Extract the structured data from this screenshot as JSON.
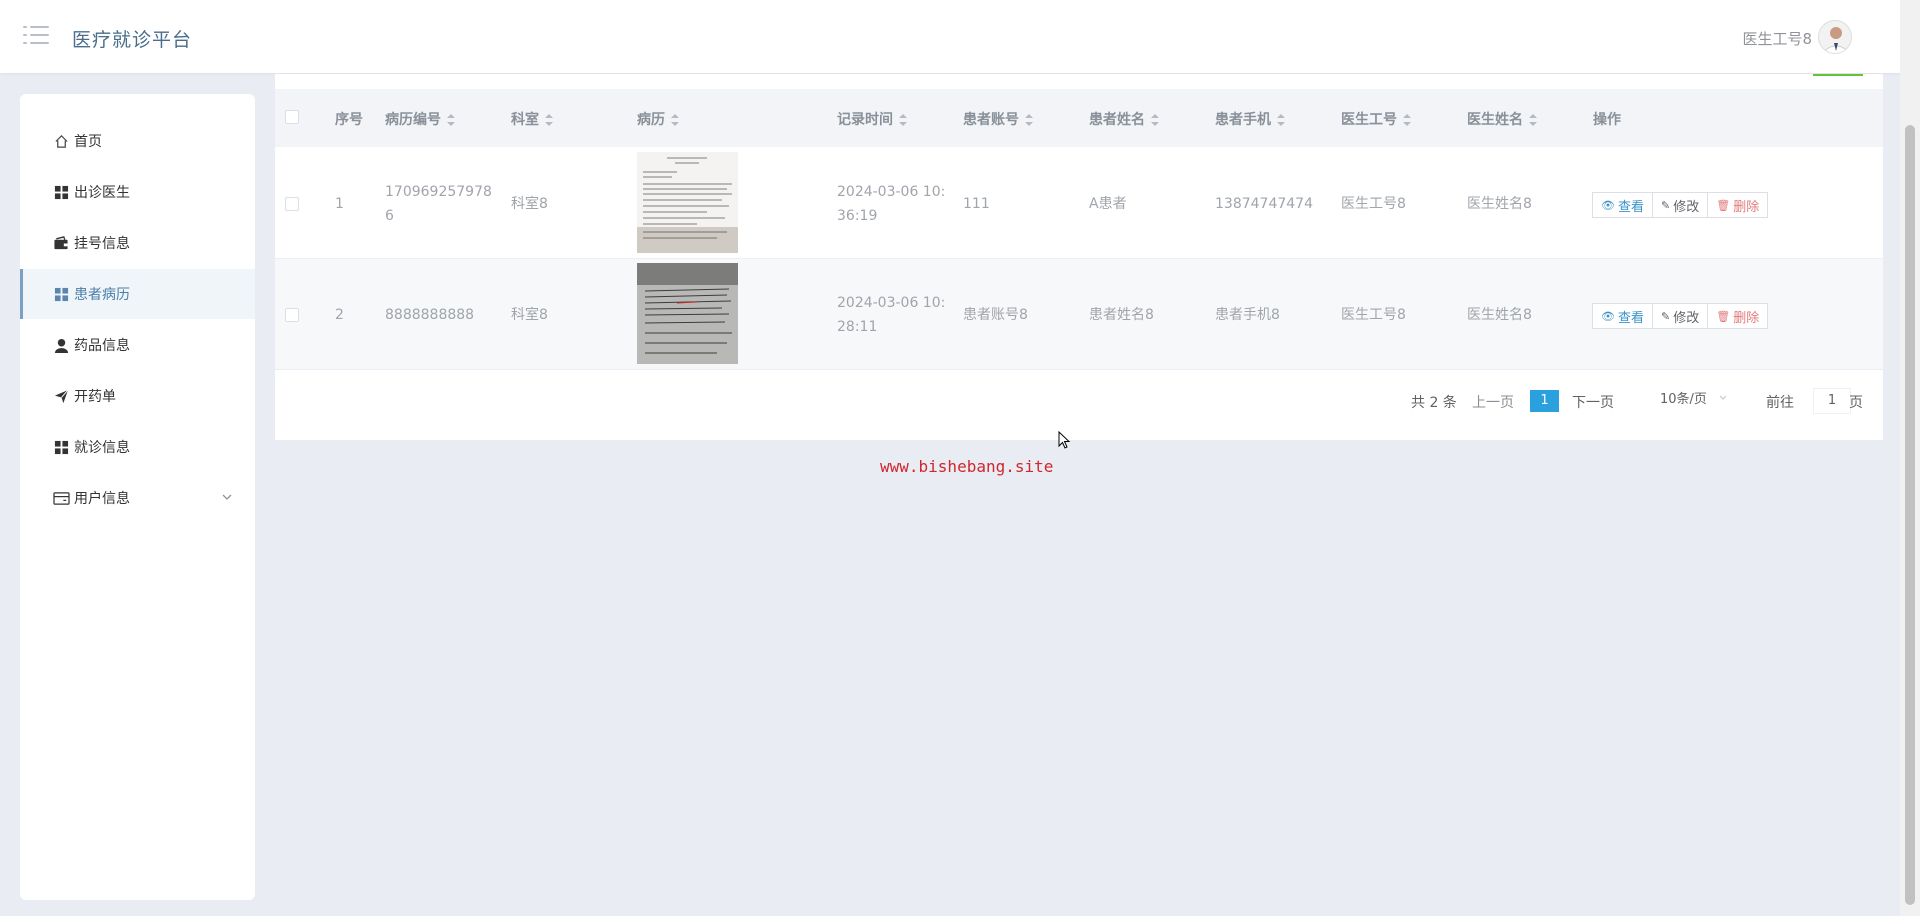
{
  "header": {
    "title": "医疗就诊平台",
    "user": "医生工号8"
  },
  "sidebar": {
    "items": [
      {
        "label": "首页",
        "icon": "home-icon"
      },
      {
        "label": "出诊医生",
        "icon": "grid-icon"
      },
      {
        "label": "挂号信息",
        "icon": "wallet-icon"
      },
      {
        "label": "患者病历",
        "icon": "grid-icon"
      },
      {
        "label": "药品信息",
        "icon": "user-icon"
      },
      {
        "label": "开药单",
        "icon": "send-icon"
      },
      {
        "label": "就诊信息",
        "icon": "grid-icon"
      },
      {
        "label": "用户信息",
        "icon": "card-icon"
      }
    ],
    "active": "患者病历"
  },
  "table": {
    "columns": [
      "序号",
      "病历编号",
      "科室",
      "病历",
      "记录时间",
      "患者账号",
      "患者姓名",
      "患者手机",
      "医生工号",
      "医生姓名",
      "操作"
    ],
    "rows": [
      {
        "index": "1",
        "record_no_1": "170969257978",
        "record_no_2": "6",
        "department": "科室8",
        "time_1": "2024-03-06 10:",
        "time_2": "36:19",
        "patient_account": "111",
        "patient_name": "A患者",
        "patient_phone": "13874747474",
        "doctor_id": "医生工号8",
        "doctor_name": "医生姓名8"
      },
      {
        "index": "2",
        "record_no_1": "8888888888",
        "record_no_2": "",
        "department": "科室8",
        "time_1": "2024-03-06 10:",
        "time_2": "28:11",
        "patient_account": "患者账号8",
        "patient_name": "患者姓名8",
        "patient_phone": "患者手机8",
        "doctor_id": "医生工号8",
        "doctor_name": "医生姓名8"
      }
    ],
    "actions": {
      "view": "查看",
      "edit": "修改",
      "delete": "删除"
    }
  },
  "pagination": {
    "total": "共 2 条",
    "prev": "上一页",
    "current": "1",
    "next": "下一页",
    "page_size": "10条/页",
    "goto_label": "前往",
    "goto_value": "1",
    "page_suffix": "页"
  },
  "watermark": "www.bishebang.site",
  "colors": {
    "accent": "#2aa0de",
    "title": "#4a6d8c",
    "delete": "#e07a7a"
  }
}
